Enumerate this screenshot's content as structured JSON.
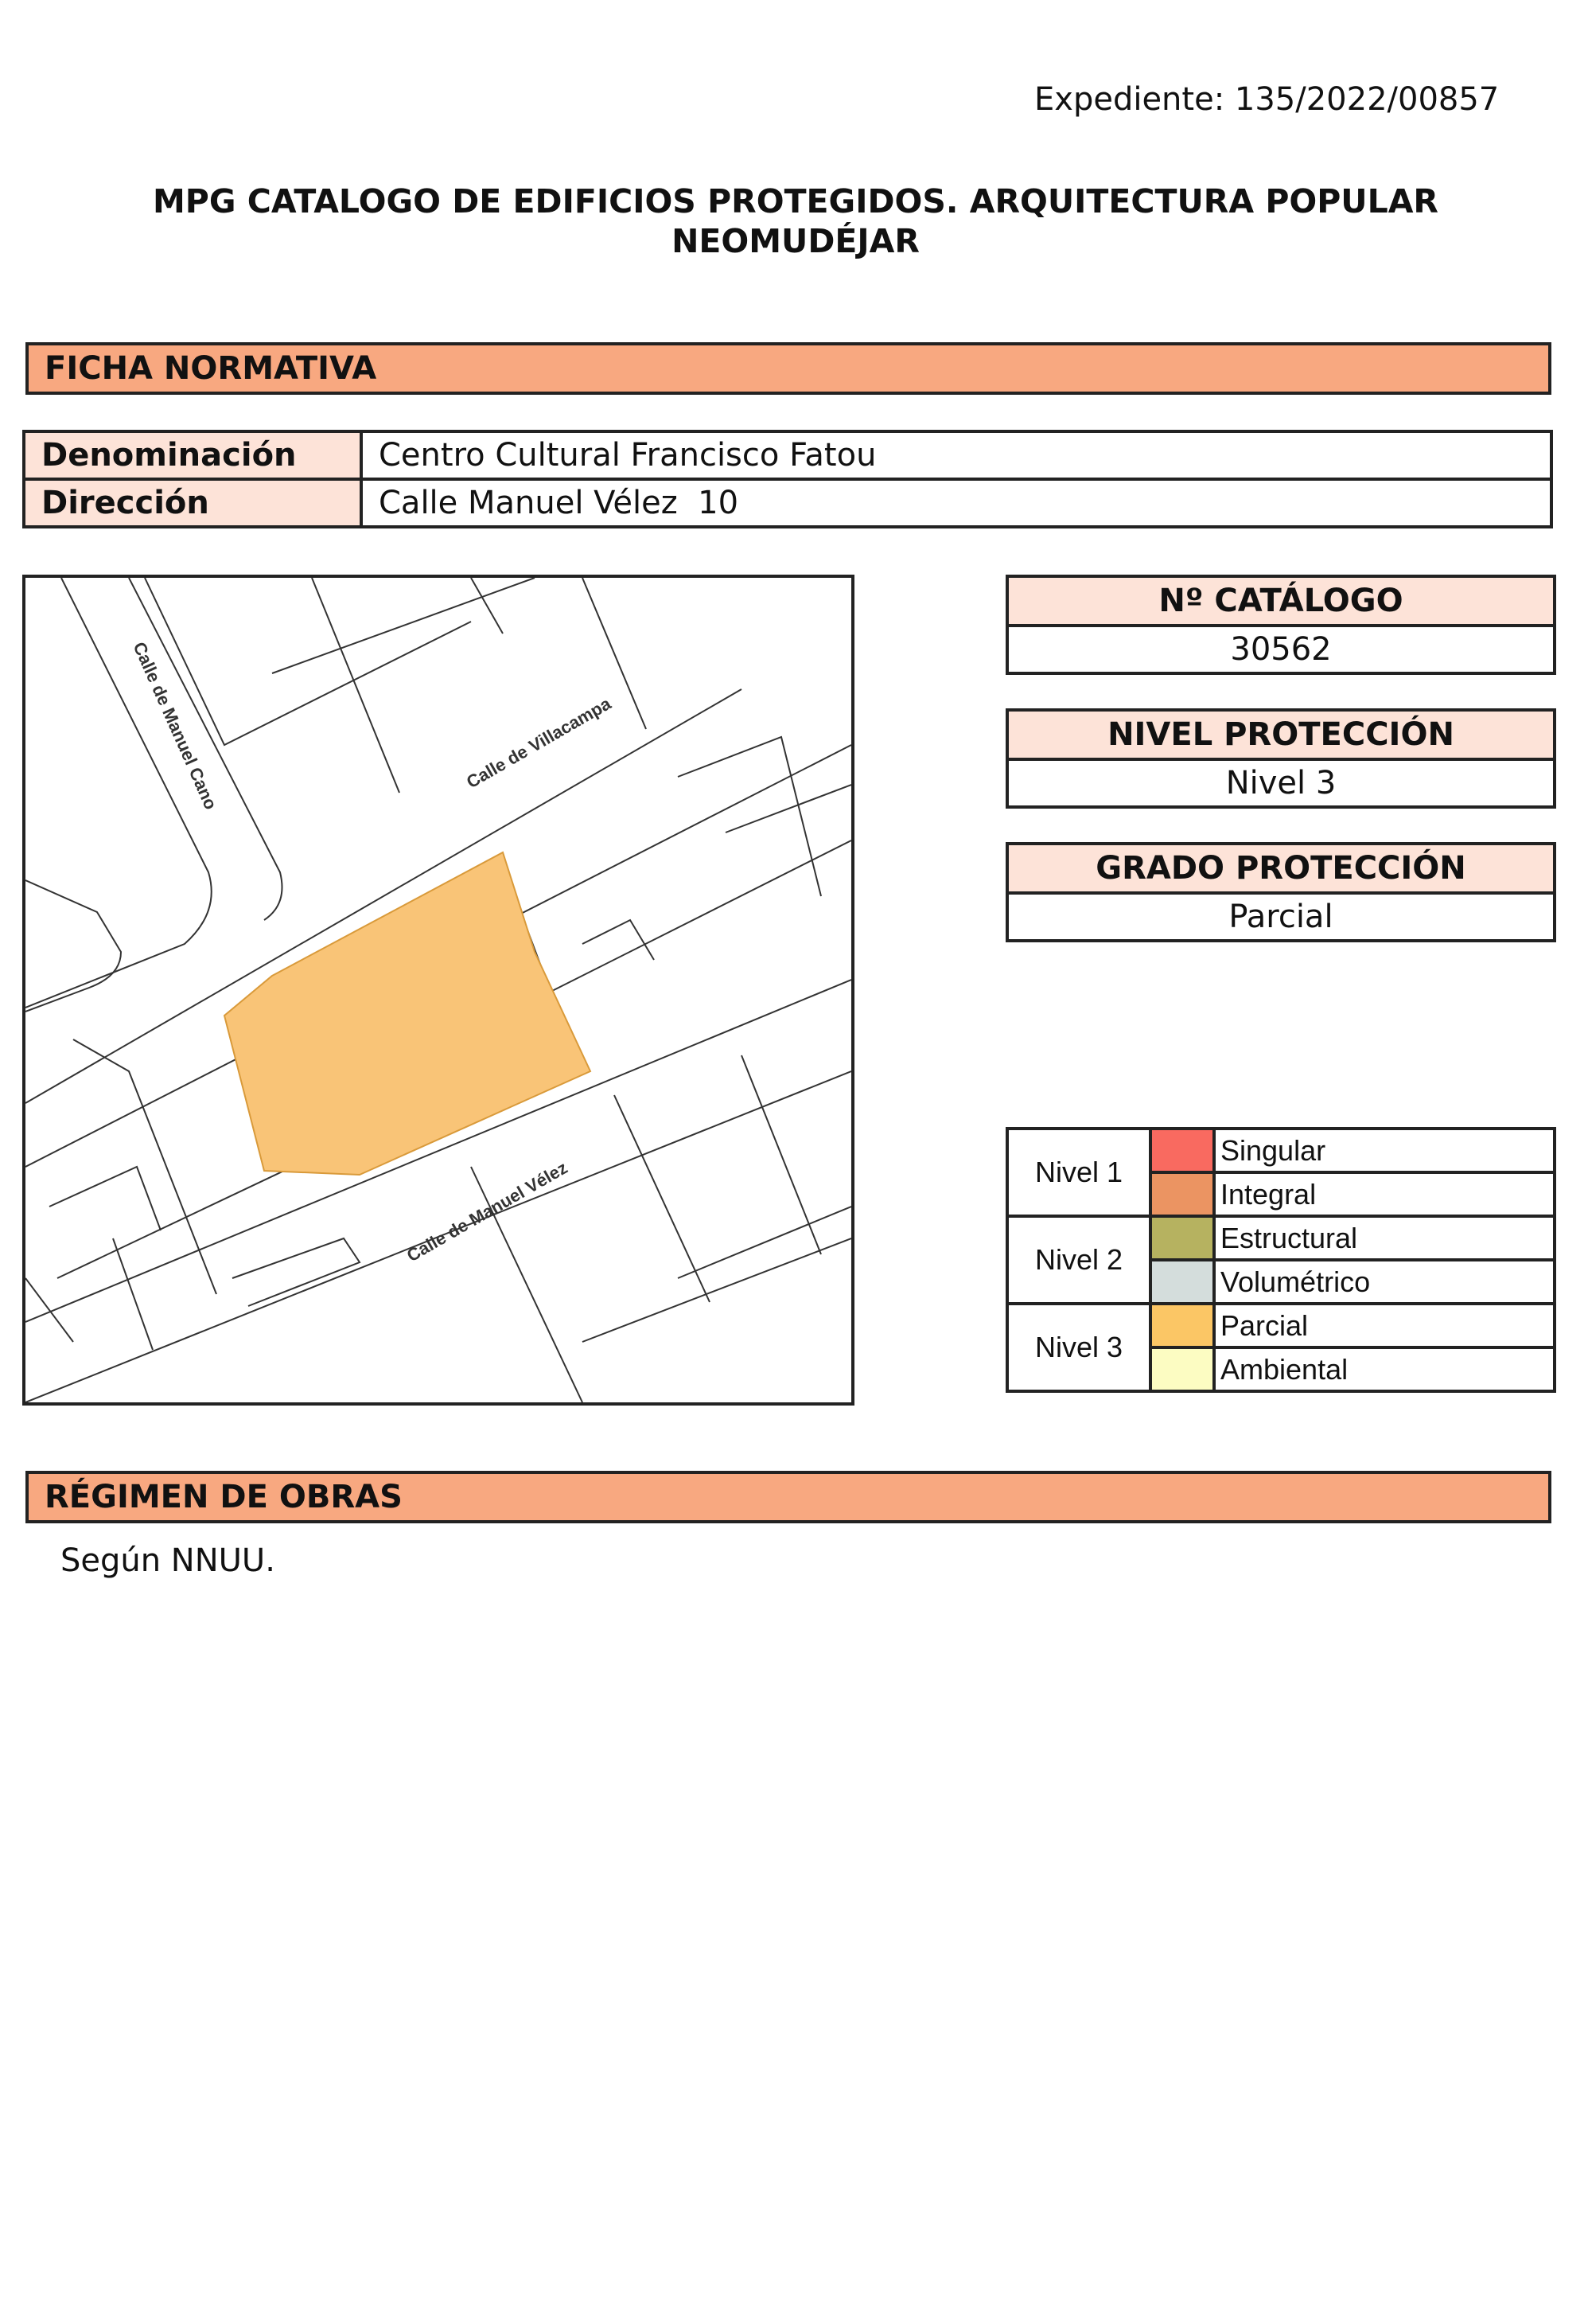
{
  "expediente": "Expediente: 135/2022/00857",
  "title_line1": "MPG CATALOGO DE EDIFICIOS PROTEGIDOS. ARQUITECTURA POPULAR",
  "title_line2": "NEOMUDÉJAR",
  "ficha_normativa": {
    "heading": "FICHA NORMATIVA",
    "denominacion_label": "Denominación",
    "denominacion_value": "Centro Cultural Francisco Fatou",
    "direccion_label": "Dirección",
    "direccion_value": "Calle Manuel Vélez  10"
  },
  "map": {
    "street_labels": [
      "Calle de Manuel Cano",
      "Calle de Villacampa",
      "Calle de Manuel Vélez"
    ],
    "parcel_color": "#f9c477"
  },
  "catalogo": {
    "label": "Nº CATÁLOGO",
    "value": "30562"
  },
  "nivel_proteccion": {
    "label": "NIVEL PROTECCIÓN",
    "value": "Nivel 3"
  },
  "grado_proteccion": {
    "label": "GRADO PROTECCIÓN",
    "value": "Parcial"
  },
  "legend": {
    "levels": [
      {
        "name": "Nivel 1",
        "items": [
          {
            "label": "Singular",
            "color": "#f96a60"
          },
          {
            "label": "Integral",
            "color": "#eb9462"
          }
        ]
      },
      {
        "name": "Nivel 2",
        "items": [
          {
            "label": "Estructural",
            "color": "#b6b260"
          },
          {
            "label": "Volumétrico",
            "color": "#d4dddc"
          }
        ]
      },
      {
        "name": "Nivel 3",
        "items": [
          {
            "label": "Parcial",
            "color": "#fbc665"
          },
          {
            "label": "Ambiental",
            "color": "#fcfcc2"
          }
        ]
      }
    ]
  },
  "regimen_obras": {
    "heading": "RÉGIMEN DE OBRAS",
    "text": "Según NNUU."
  }
}
